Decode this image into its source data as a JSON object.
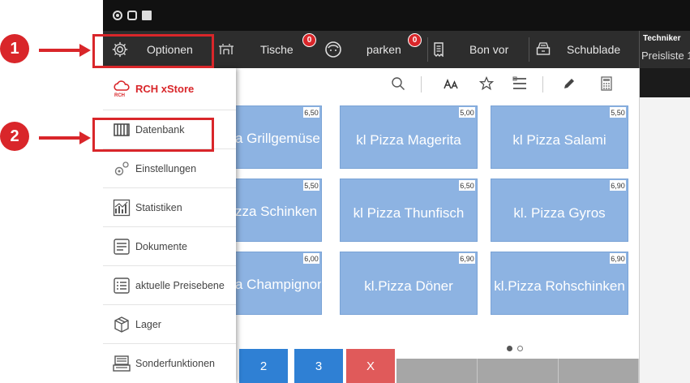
{
  "annotations": {
    "callout_1": "1",
    "callout_2": "2"
  },
  "toolbar": {
    "options_label": "Optionen",
    "tables_label": "Tische",
    "tables_badge": "0",
    "park_label": "parken",
    "park_badge": "0",
    "bon_label": "Bon vor",
    "drawer_label": "Schublade"
  },
  "user": {
    "name": "Techniker",
    "price_list": "Preisliste 1"
  },
  "tool_icons": [
    "search-icon",
    "text-size-icon",
    "star-icon",
    "list-icon",
    "pencil-icon",
    "calculator-icon"
  ],
  "menu": {
    "store_label": "RCH xStore",
    "items": [
      {
        "label": "Datenbank",
        "icon": "database-icon"
      },
      {
        "label": "Einstellungen",
        "icon": "settings-icon"
      },
      {
        "label": "Statistiken",
        "icon": "statistics-icon"
      },
      {
        "label": "Dokumente",
        "icon": "documents-icon"
      },
      {
        "label": "aktuelle Preisebene",
        "icon": "price-level-icon"
      },
      {
        "label": "Lager",
        "icon": "warehouse-icon"
      },
      {
        "label": "Sonderfunktionen",
        "icon": "special-functions-icon"
      }
    ]
  },
  "products": [
    {
      "name": "a Grillgemüse",
      "price": "6,50"
    },
    {
      "name": "kl Pizza Magerita",
      "price": "5,00"
    },
    {
      "name": "kl Pizza Salami",
      "price": "5,50"
    },
    {
      "name": "zza Schinken",
      "price": "5,50"
    },
    {
      "name": "kl Pizza Thunfisch",
      "price": "6,50"
    },
    {
      "name": "kl. Pizza Gyros",
      "price": "6,90"
    },
    {
      "name": "a Champignon",
      "price": "6,00"
    },
    {
      "name": "kl.Pizza Döner",
      "price": "6,90"
    },
    {
      "name": "kl.Pizza Rohschinken",
      "price": "6,90"
    }
  ],
  "keys": {
    "two": "2",
    "three": "3",
    "cancel": "X"
  },
  "colors": {
    "accent": "#d9262a",
    "product": "#8db3e2",
    "key_blue": "#2f80d4",
    "key_red": "#e05a5a"
  }
}
